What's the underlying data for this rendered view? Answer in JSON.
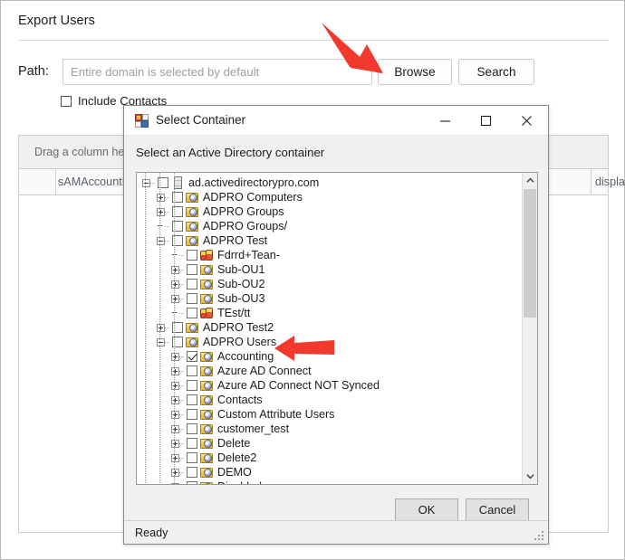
{
  "app": {
    "title": "Export Users",
    "path_label": "Path:",
    "path_value": "",
    "path_placeholder": "Entire domain is selected by default",
    "browse_label": "Browse",
    "search_label": "Search",
    "include_contacts_label": "Include Contacts",
    "include_contacts_checked": false
  },
  "grid": {
    "drag_hint": "Drag a column header h",
    "columns": [
      "sAMAccountN",
      "displa"
    ]
  },
  "dialog": {
    "title": "Select Container",
    "icon": "app-window-icon",
    "prompt": "Select an Active Directory container",
    "minimize_label": "─",
    "maximize_label": "☐",
    "close_label": "✕",
    "ok_label": "OK",
    "cancel_label": "Cancel",
    "status": "Ready",
    "tree": [
      {
        "label": "ad.activedirectorypro.com",
        "depth": 0,
        "expander": "minus",
        "icon": "domain",
        "checked": false
      },
      {
        "label": "ADPRO Computers",
        "depth": 1,
        "expander": "plus",
        "icon": "ou",
        "checked": false
      },
      {
        "label": "ADPRO Groups",
        "depth": 1,
        "expander": "plus",
        "icon": "ou",
        "checked": false
      },
      {
        "label": "ADPRO Groups/",
        "depth": 1,
        "expander": "none",
        "icon": "ou",
        "checked": false
      },
      {
        "label": "ADPRO Test",
        "depth": 1,
        "expander": "minus",
        "icon": "ou",
        "checked": false
      },
      {
        "label": "Fdrrd+Tean-",
        "depth": 2,
        "expander": "none",
        "icon": "grp",
        "checked": false
      },
      {
        "label": "Sub-OU1",
        "depth": 2,
        "expander": "plus",
        "icon": "ou",
        "checked": false
      },
      {
        "label": "Sub-OU2",
        "depth": 2,
        "expander": "plus",
        "icon": "ou",
        "checked": false
      },
      {
        "label": "Sub-OU3",
        "depth": 2,
        "expander": "plus",
        "icon": "ou",
        "checked": false
      },
      {
        "label": "TEst/tt",
        "depth": 2,
        "expander": "none",
        "icon": "grp",
        "checked": false
      },
      {
        "label": "ADPRO Test2",
        "depth": 1,
        "expander": "plus",
        "icon": "ou",
        "checked": false
      },
      {
        "label": "ADPRO Users",
        "depth": 1,
        "expander": "minus",
        "icon": "ou",
        "checked": false
      },
      {
        "label": "Accounting",
        "depth": 2,
        "expander": "plus",
        "icon": "ou",
        "checked": true
      },
      {
        "label": "Azure AD Connect",
        "depth": 2,
        "expander": "plus",
        "icon": "ou",
        "checked": false
      },
      {
        "label": "Azure AD Connect NOT Synced",
        "depth": 2,
        "expander": "plus",
        "icon": "ou",
        "checked": false
      },
      {
        "label": "Contacts",
        "depth": 2,
        "expander": "plus",
        "icon": "ou",
        "checked": false
      },
      {
        "label": "Custom Attribute Users",
        "depth": 2,
        "expander": "plus",
        "icon": "ou",
        "checked": false
      },
      {
        "label": "customer_test",
        "depth": 2,
        "expander": "plus",
        "icon": "ou",
        "checked": false
      },
      {
        "label": "Delete",
        "depth": 2,
        "expander": "plus",
        "icon": "ou",
        "checked": false
      },
      {
        "label": "Delete2",
        "depth": 2,
        "expander": "plus",
        "icon": "ou",
        "checked": false
      },
      {
        "label": "DEMO",
        "depth": 2,
        "expander": "plus",
        "icon": "ou",
        "checked": false
      },
      {
        "label": "Disabled",
        "depth": 2,
        "expander": "plus",
        "icon": "ou",
        "checked": false
      }
    ]
  },
  "annotations": {
    "color": "#f2392e",
    "arrows": [
      {
        "name": "arrow-to-browse-button",
        "target": "Browse"
      },
      {
        "name": "arrow-to-accounting-node",
        "target": "Accounting"
      }
    ]
  }
}
